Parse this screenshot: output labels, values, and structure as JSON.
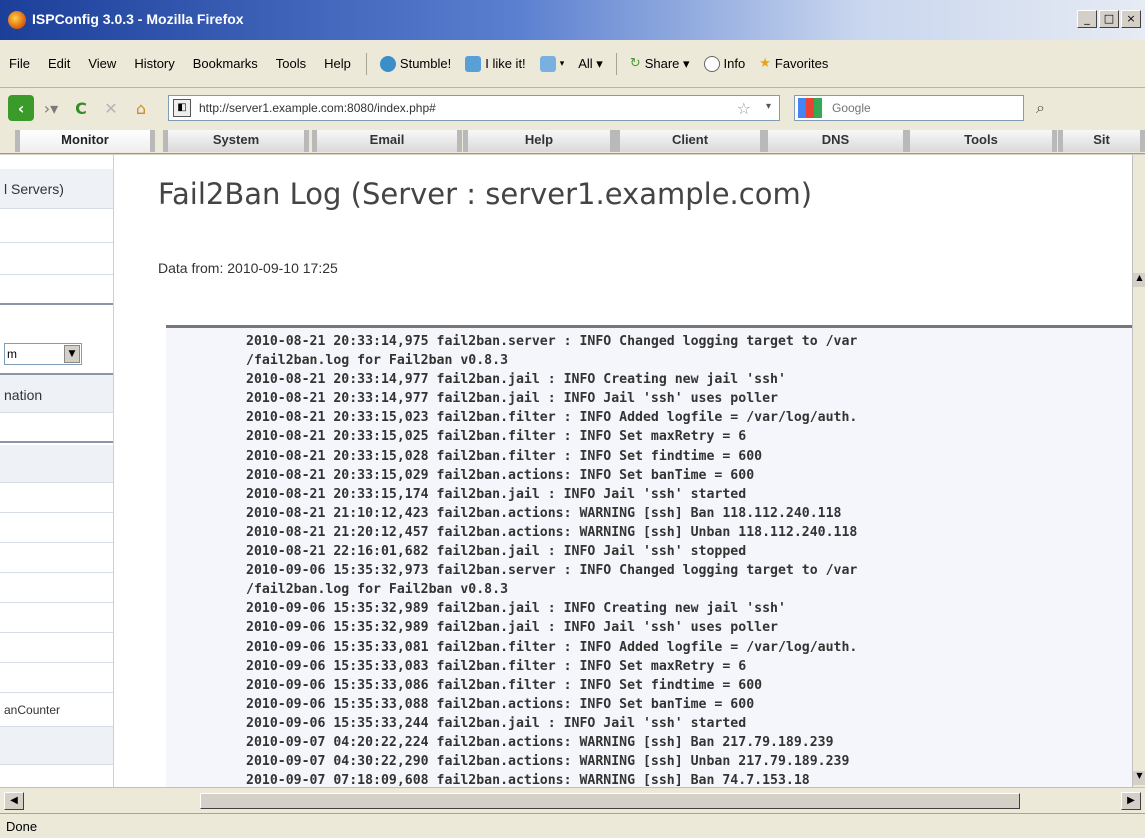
{
  "window": {
    "title": "ISPConfig 3.0.3 - Mozilla Firefox",
    "controls": [
      "_",
      "□",
      "×"
    ]
  },
  "menu": {
    "items": [
      "File",
      "Edit",
      "View",
      "History",
      "Bookmarks",
      "Tools",
      "Help"
    ],
    "toolbar": {
      "stumble": "Stumble!",
      "ilike": "I like it!",
      "all": "All ▾",
      "share": "Share ▾",
      "info": "Info",
      "favorites": "Favorites"
    }
  },
  "nav": {
    "url": "http://server1.example.com:8080/index.php#",
    "search_placeholder": "Google"
  },
  "tabs": [
    "Monitor",
    "System",
    "Email",
    "Help",
    "Client",
    "DNS",
    "Tools",
    "Sit"
  ],
  "sidebar": {
    "servers_label": "l Servers)",
    "select_value": "m",
    "information_label": "nation",
    "bancounter_label": "anCounter"
  },
  "main": {
    "title": "Fail2Ban Log (Server : server1.example.com)",
    "data_from": "Data from: 2010-09-10 17:25",
    "log_lines": [
      "2010-08-21 20:33:14,975 fail2ban.server : INFO Changed logging target to /var",
      "/fail2ban.log for Fail2ban v0.8.3",
      "2010-08-21 20:33:14,977 fail2ban.jail : INFO Creating new jail 'ssh'",
      "2010-08-21 20:33:14,977 fail2ban.jail : INFO Jail 'ssh' uses poller",
      "2010-08-21 20:33:15,023 fail2ban.filter : INFO Added logfile = /var/log/auth.",
      "2010-08-21 20:33:15,025 fail2ban.filter : INFO Set maxRetry = 6",
      "2010-08-21 20:33:15,028 fail2ban.filter : INFO Set findtime = 600",
      "2010-08-21 20:33:15,029 fail2ban.actions: INFO Set banTime = 600",
      "2010-08-21 20:33:15,174 fail2ban.jail : INFO Jail 'ssh' started",
      "2010-08-21 21:10:12,423 fail2ban.actions: WARNING [ssh] Ban 118.112.240.118",
      "2010-08-21 21:20:12,457 fail2ban.actions: WARNING [ssh] Unban 118.112.240.118",
      "2010-08-21 22:16:01,682 fail2ban.jail : INFO Jail 'ssh' stopped",
      "2010-09-06 15:35:32,973 fail2ban.server : INFO Changed logging target to /var",
      "/fail2ban.log for Fail2ban v0.8.3",
      "2010-09-06 15:35:32,989 fail2ban.jail : INFO Creating new jail 'ssh'",
      "2010-09-06 15:35:32,989 fail2ban.jail : INFO Jail 'ssh' uses poller",
      "2010-09-06 15:35:33,081 fail2ban.filter : INFO Added logfile = /var/log/auth.",
      "2010-09-06 15:35:33,083 fail2ban.filter : INFO Set maxRetry = 6",
      "2010-09-06 15:35:33,086 fail2ban.filter : INFO Set findtime = 600",
      "2010-09-06 15:35:33,088 fail2ban.actions: INFO Set banTime = 600",
      "2010-09-06 15:35:33,244 fail2ban.jail : INFO Jail 'ssh' started",
      "2010-09-07 04:20:22,224 fail2ban.actions: WARNING [ssh] Ban 217.79.189.239",
      "2010-09-07 04:30:22,290 fail2ban.actions: WARNING [ssh] Unban 217.79.189.239",
      "2010-09-07 07:18:09,608 fail2ban.actions: WARNING [ssh] Ban 74.7.153.18"
    ]
  },
  "status": "Done",
  "colors": {
    "titlebar": "#1c3f9a",
    "chrome": "#ece9d8",
    "log_bg": "#f4f6fb"
  }
}
